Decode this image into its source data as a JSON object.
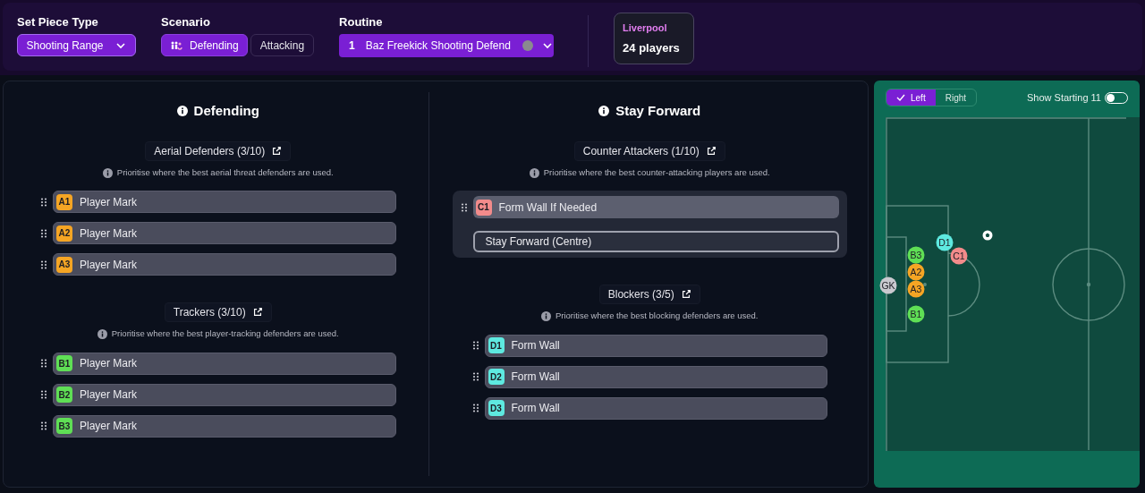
{
  "top_bar": {
    "set_piece_type": {
      "label": "Set Piece Type",
      "value": "Shooting Range"
    },
    "scenario": {
      "label": "Scenario",
      "options": [
        {
          "label": "Defending",
          "selected": true
        },
        {
          "label": "Attacking",
          "selected": false
        }
      ]
    },
    "routine": {
      "label": "Routine",
      "number": "1",
      "value": "Baz Freekick Shooting Defend"
    },
    "team": {
      "name": "Liverpool",
      "players": "24 players"
    }
  },
  "columns": [
    {
      "title": "Defending",
      "groups": [
        {
          "title": "Aerial Defenders (3/10)",
          "hint": "Prioritise where the best aerial threat defenders are used.",
          "roles": [
            {
              "badge": "A1",
              "color": "#f5a524",
              "label": "Player Mark",
              "expanded": false
            },
            {
              "badge": "A2",
              "color": "#f5a524",
              "label": "Player Mark",
              "expanded": false
            },
            {
              "badge": "A3",
              "color": "#f5a524",
              "label": "Player Mark",
              "expanded": false
            }
          ]
        },
        {
          "title": "Trackers (3/10)",
          "hint": "Prioritise where the best player-tracking defenders are used.",
          "roles": [
            {
              "badge": "B1",
              "color": "#5fdf55",
              "label": "Player Mark",
              "expanded": false
            },
            {
              "badge": "B2",
              "color": "#5fdf55",
              "label": "Player Mark",
              "expanded": false
            },
            {
              "badge": "B3",
              "color": "#5fdf55",
              "label": "Player Mark",
              "expanded": false
            }
          ]
        }
      ]
    },
    {
      "title": "Stay Forward",
      "groups": [
        {
          "title": "Counter Attackers (1/10)",
          "hint": "Prioritise where the best counter-attacking players are used.",
          "roles": [
            {
              "badge": "C1",
              "color": "#f28b8b",
              "label": "Form Wall If Needed",
              "expanded": true,
              "option": "Stay Forward (Centre)"
            }
          ]
        },
        {
          "title": "Blockers (3/5)",
          "hint": "Prioritise where the best blocking defenders are used.",
          "roles": [
            {
              "badge": "D1",
              "color": "#5ee9e0",
              "label": "Form Wall",
              "expanded": false
            },
            {
              "badge": "D2",
              "color": "#5ee9e0",
              "label": "Form Wall",
              "expanded": false
            },
            {
              "badge": "D3",
              "color": "#5ee9e0",
              "label": "Form Wall",
              "expanded": false
            }
          ]
        }
      ]
    }
  ],
  "pitch": {
    "sides": [
      {
        "label": "Left",
        "selected": true
      },
      {
        "label": "Right",
        "selected": false
      }
    ],
    "show_starting_11": {
      "label": "Show Starting 11",
      "on": false
    },
    "tokens": [
      {
        "label": "GK",
        "color": "#c9c9cf"
      },
      {
        "label": "B3",
        "color": "#5fdf55"
      },
      {
        "label": "A2",
        "color": "#f5a524"
      },
      {
        "label": "A3",
        "color": "#f5a524"
      },
      {
        "label": "B1",
        "color": "#5fdf55"
      },
      {
        "label": "D1",
        "color": "#5ee9e0"
      },
      {
        "label": "C1",
        "color": "#f28b8b"
      }
    ]
  }
}
